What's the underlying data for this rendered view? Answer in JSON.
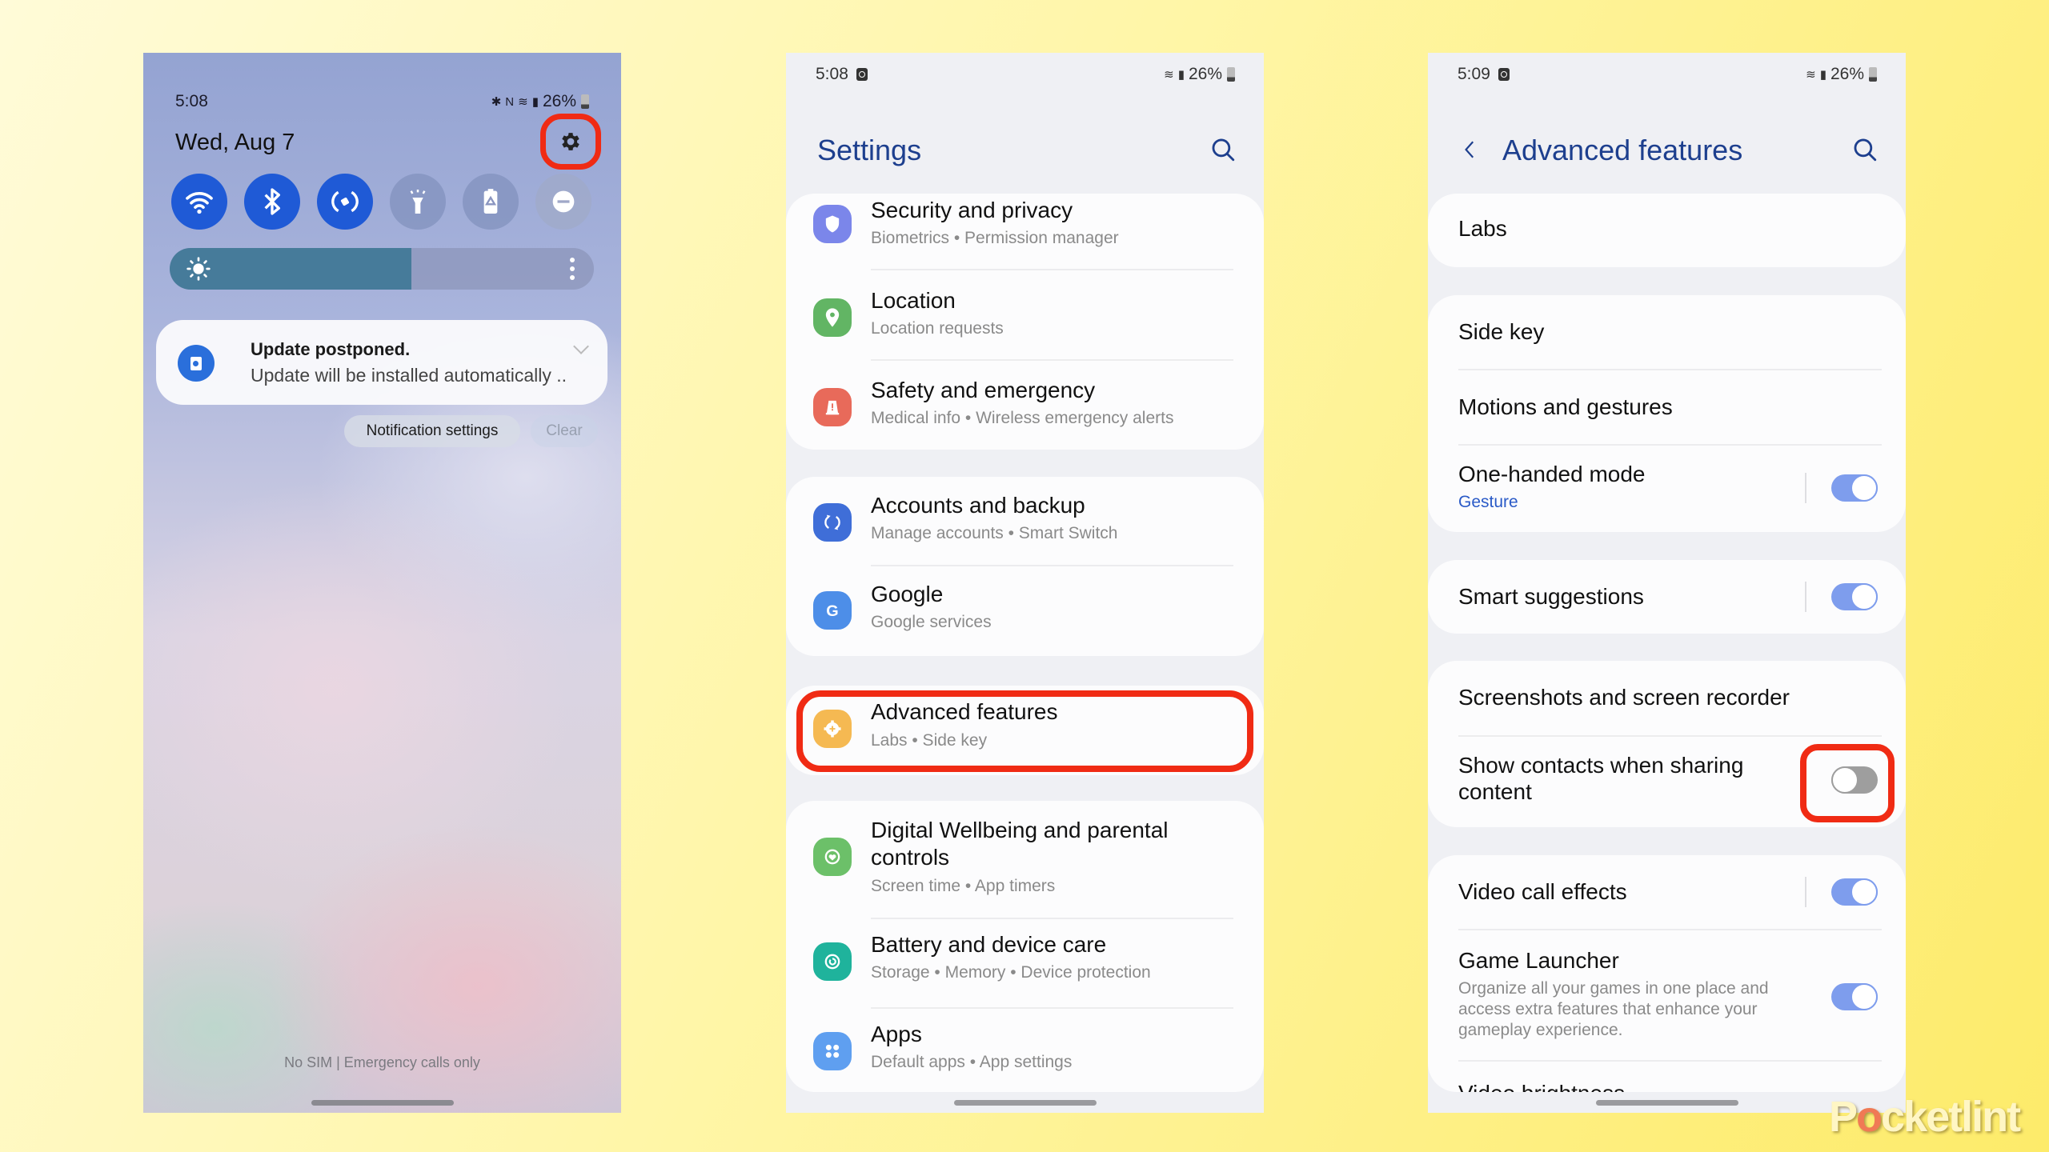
{
  "phone1": {
    "status": {
      "time": "5:08",
      "battery": "26%",
      "icons": [
        "bluetooth-icon",
        "nfc-icon",
        "wifi-icon",
        "signal-icon",
        "battery-icon"
      ]
    },
    "date": "Wed, Aug 7",
    "settings_icon": "gear-icon",
    "quick_settings": [
      {
        "name": "wifi",
        "icon": "wifi-icon",
        "state": "on"
      },
      {
        "name": "bluetooth",
        "icon": "bluetooth-icon",
        "state": "on"
      },
      {
        "name": "auto-rotate",
        "icon": "rotate-icon",
        "state": "on"
      },
      {
        "name": "flashlight",
        "icon": "flashlight-icon",
        "state": "off"
      },
      {
        "name": "power-saving",
        "icon": "battery-saver-icon",
        "state": "off"
      },
      {
        "name": "do-not-disturb",
        "icon": "dnd-icon",
        "state": "off"
      }
    ],
    "brightness_percent": 57,
    "notification": {
      "title": "Update postponed.",
      "text": "Update will be installed automatically .."
    },
    "notification_settings_label": "Notification settings",
    "clear_label": "Clear",
    "footer": "No SIM | Emergency calls only"
  },
  "phone2": {
    "status": {
      "time": "5:08",
      "battery": "26%"
    },
    "title": "Settings",
    "groups": [
      [
        {
          "title": "Security and privacy",
          "subtitle": "Biometrics  •  Permission manager",
          "icon": "shield-icon",
          "color": "#7b86ea"
        },
        {
          "title": "Location",
          "subtitle": "Location requests",
          "icon": "location-pin-icon",
          "color": "#62b564"
        },
        {
          "title": "Safety and emergency",
          "subtitle": "Medical info  •  Wireless emergency alerts",
          "icon": "emergency-icon",
          "color": "#e86a5a"
        }
      ],
      [
        {
          "title": "Accounts and backup",
          "subtitle": "Manage accounts  •  Smart Switch",
          "icon": "sync-icon",
          "color": "#3f6ed8"
        },
        {
          "title": "Google",
          "subtitle": "Google services",
          "icon": "google-icon",
          "color": "#4d8ee8"
        }
      ],
      [
        {
          "title": "Advanced features",
          "subtitle": "Labs  •  Side key",
          "icon": "advanced-gear-icon",
          "color": "#f5b952"
        }
      ],
      [
        {
          "title": "Digital Wellbeing and parental controls",
          "subtitle": "Screen time  •  App timers",
          "icon": "wellbeing-icon",
          "color": "#6cc069"
        },
        {
          "title": "Battery and device care",
          "subtitle": "Storage  •  Memory  •  Device protection",
          "icon": "device-care-icon",
          "color": "#1fb39c"
        },
        {
          "title": "Apps",
          "subtitle": "Default apps  •  App settings",
          "icon": "apps-icon",
          "color": "#5f9ff0"
        }
      ]
    ]
  },
  "phone3": {
    "status": {
      "time": "5:09",
      "battery": "26%"
    },
    "title": "Advanced features",
    "items": [
      {
        "title": "Labs"
      },
      {
        "title": "Side key"
      },
      {
        "title": "Motions and gestures"
      },
      {
        "title": "One-handed mode",
        "subtitle": "Gesture",
        "toggle": true
      },
      {
        "title": "Smart suggestions",
        "toggle": true
      },
      {
        "title": "Screenshots and screen recorder"
      },
      {
        "title": "Show contacts when sharing content",
        "toggle": false
      },
      {
        "title": "Video call effects",
        "toggle": true
      },
      {
        "title": "Game Launcher",
        "subtitle": "Organize all your games in one place and access extra features that enhance your gameplay experience.",
        "toggle": true
      },
      {
        "title": "Video brightness"
      }
    ]
  },
  "watermark": {
    "prefix": "P",
    "o": "o",
    "suffix": "cketlint"
  },
  "colors": {
    "highlight": "#f02b14",
    "title_blue": "#1d3f8e",
    "toggle_on": "#7e9ded",
    "background": "#fff49a"
  }
}
